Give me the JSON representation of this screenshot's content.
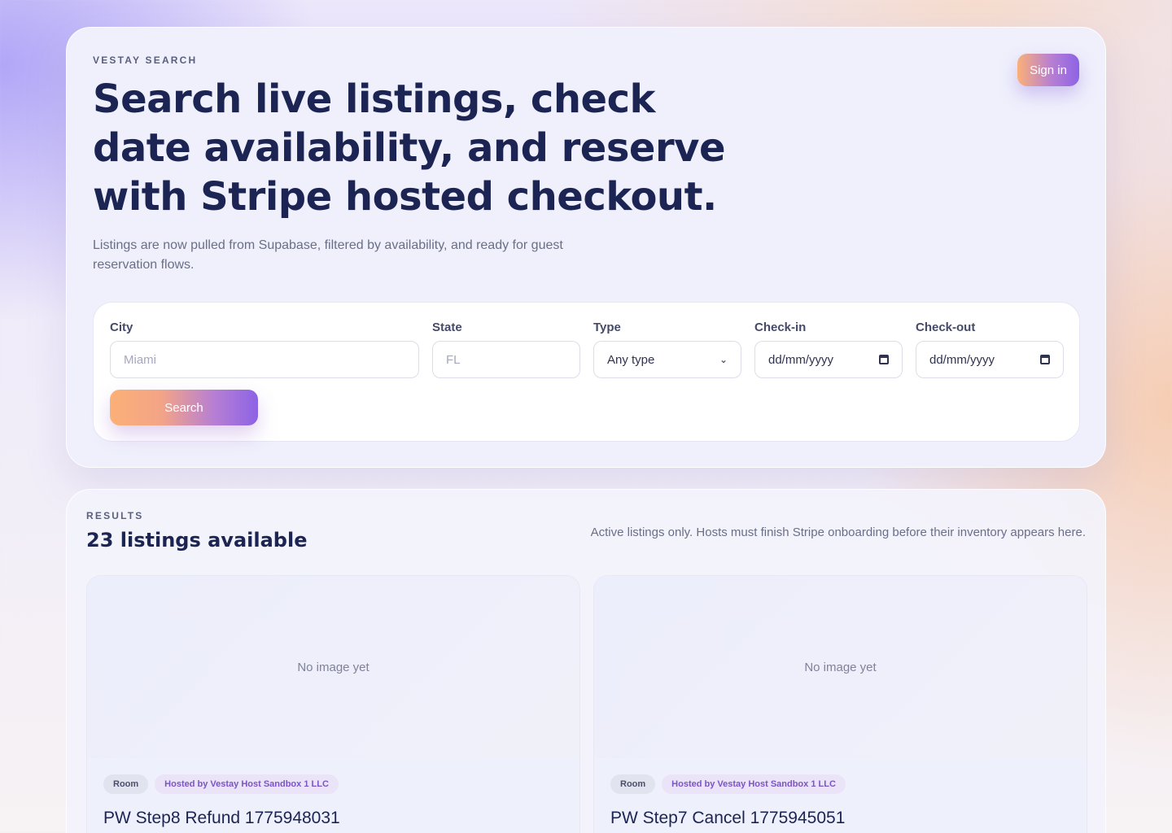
{
  "hero": {
    "eyebrow": "VESTAY SEARCH",
    "headline": "Search live listings, check date availability, and reserve with Stripe hosted checkout.",
    "subtitle": "Listings are now pulled from Supabase, filtered by availability, and ready for guest reservation flows.",
    "signin_label": "Sign in"
  },
  "form": {
    "city": {
      "label": "City",
      "placeholder": "Miami"
    },
    "state": {
      "label": "State",
      "placeholder": "FL"
    },
    "type": {
      "label": "Type",
      "value": "Any type"
    },
    "checkin": {
      "label": "Check-in",
      "value": "dd/mm/yyyy"
    },
    "checkout": {
      "label": "Check-out",
      "value": "dd/mm/yyyy"
    },
    "search_label": "Search"
  },
  "results": {
    "eyebrow": "RESULTS",
    "title": "23 listings available",
    "note": "Active listings only. Hosts must finish Stripe onboarding before their inventory appears here.",
    "cards": [
      {
        "image_text": "No image yet",
        "type": "Room",
        "host": "Hosted by Vestay Host Sandbox 1 LLC",
        "title": "PW Step8 Refund 1775948031"
      },
      {
        "image_text": "No image yet",
        "type": "Room",
        "host": "Hosted by Vestay Host Sandbox 1 LLC",
        "title": "PW Step7 Cancel 1775945051"
      }
    ]
  }
}
